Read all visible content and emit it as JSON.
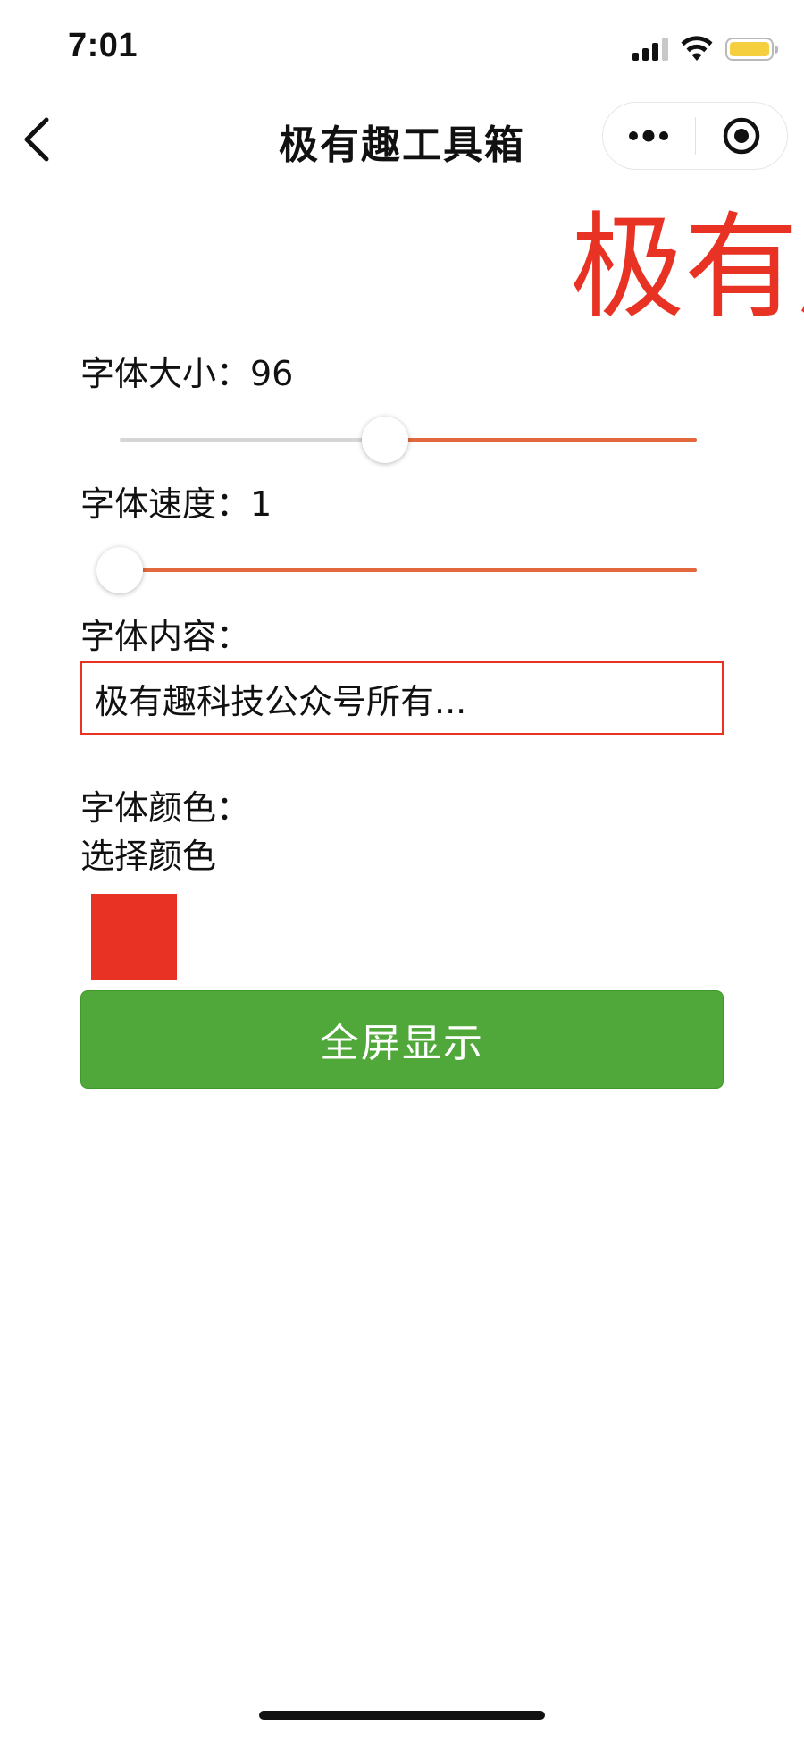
{
  "status_bar": {
    "time": "7:01"
  },
  "nav": {
    "title": "极有趣工具箱",
    "back_icon": "chevron-left-icon",
    "more_icon": "more-dots-icon",
    "close_icon": "target-circle-icon"
  },
  "preview": {
    "text": "极有趣科技公众号所有权归属于极有趣科技",
    "color": "#e83224"
  },
  "font_size": {
    "label": "字体大小：96",
    "value": 96,
    "fraction": 0.46
  },
  "font_speed": {
    "label": "字体速度：1",
    "value": 1,
    "fraction": 0.0
  },
  "content": {
    "label": "字体内容：",
    "value": "极有趣科技公众号所有..."
  },
  "color": {
    "label": "字体颜色：",
    "picker_label": "选择颜色",
    "selected": "#e83224"
  },
  "action": {
    "fullscreen_label": "全屏显示",
    "color": "#51a83a"
  },
  "theme": {
    "slider_active": "#e4683d",
    "slider_inactive": "#d6d6d6"
  }
}
